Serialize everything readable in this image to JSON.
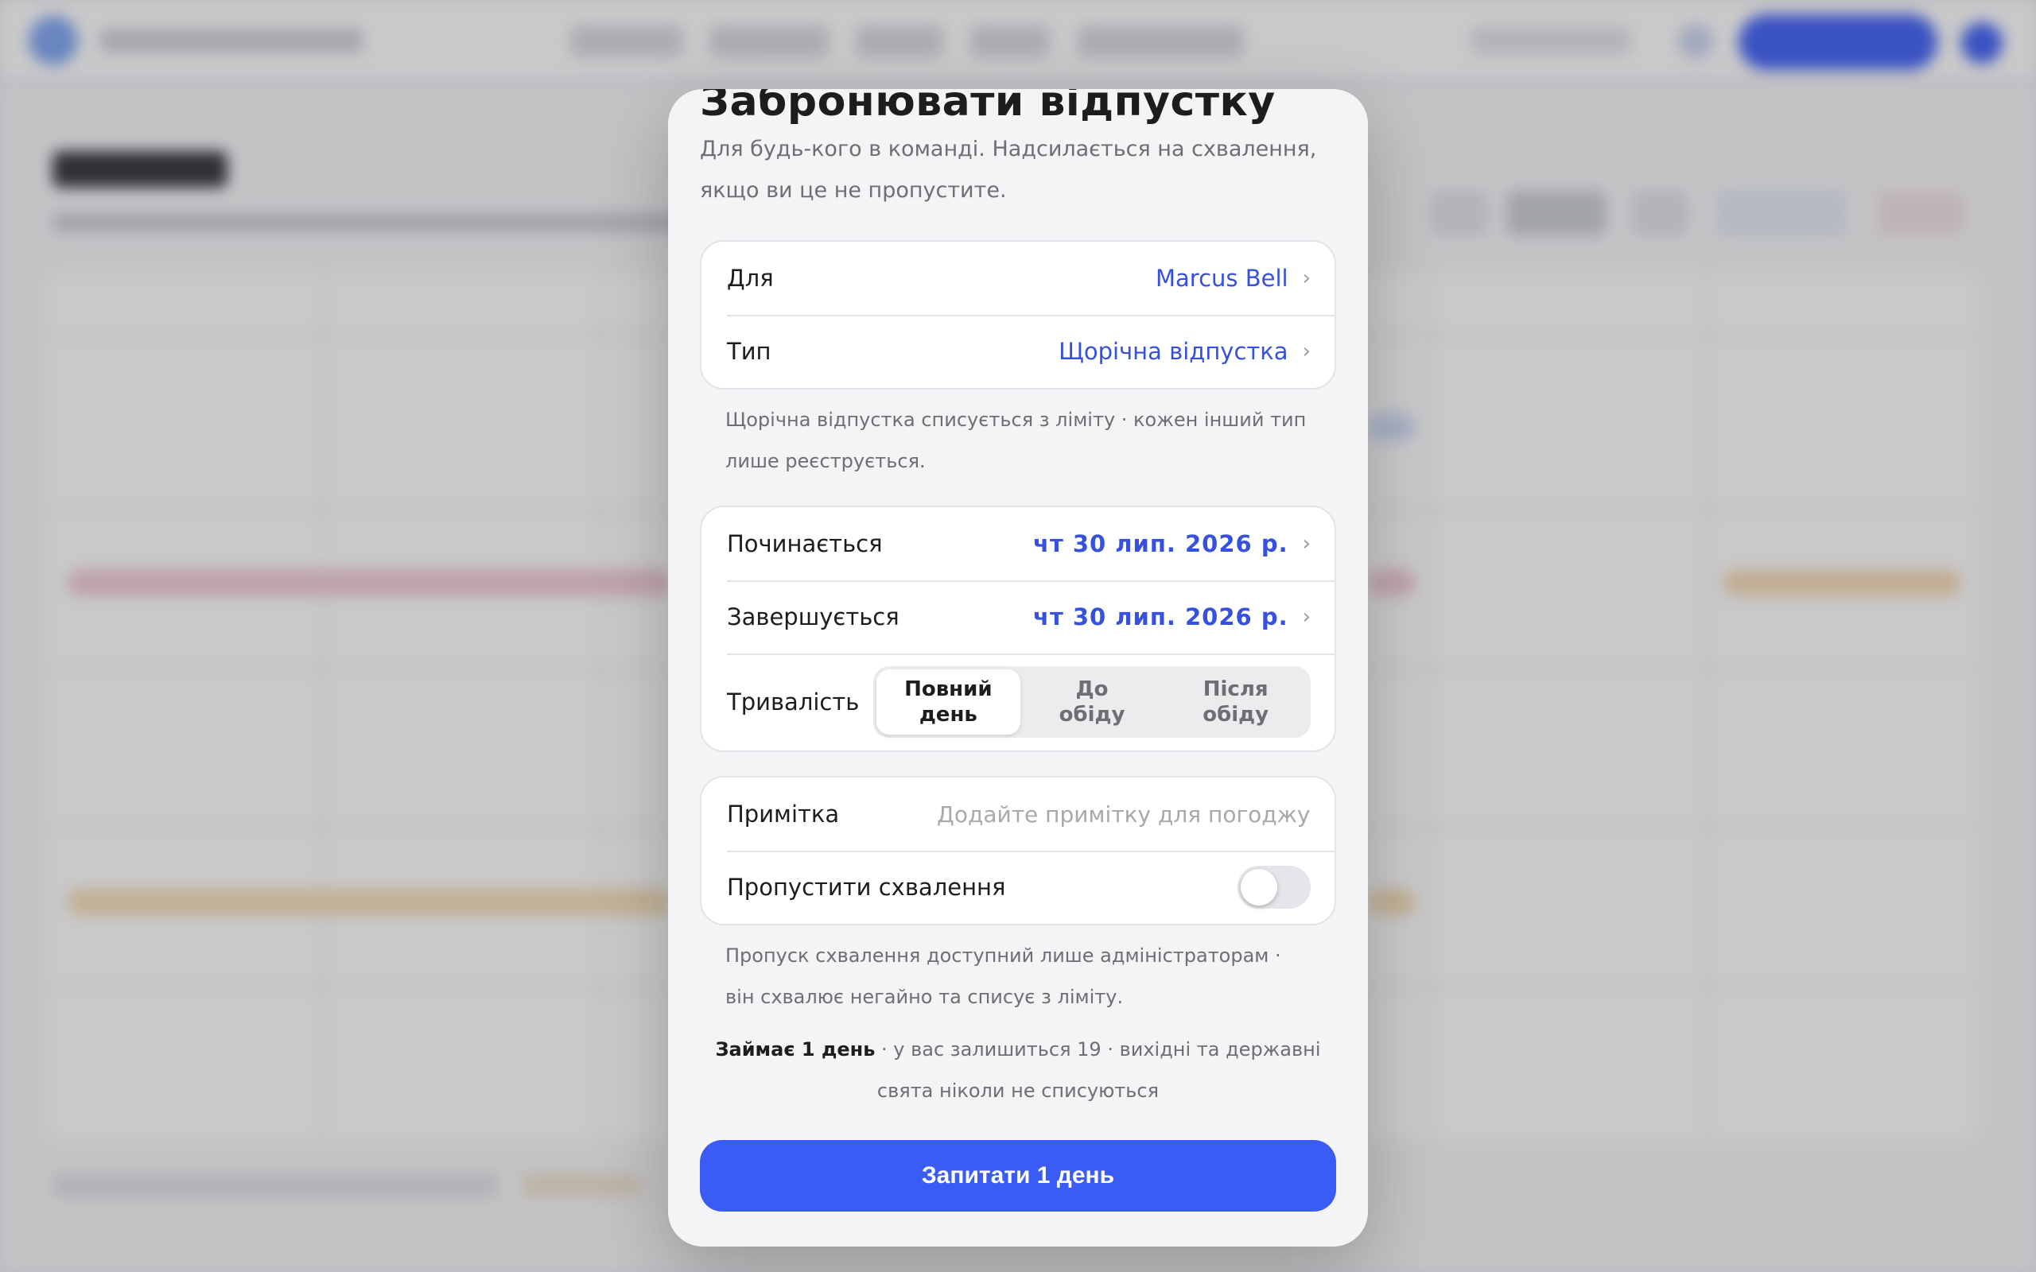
{
  "dialog": {
    "title": "Забронювати відпустку",
    "subtitle": "Для будь-кого в команді. Надсилається на схвалення, якщо ви це не пропустите.",
    "for_label": "Для",
    "for_value": "Marcus Bell",
    "type_label": "Тип",
    "type_value": "Щорічна відпустка",
    "type_note": "Щорічна відпустка списується з ліміту · кожен інший тип лише реєструється.",
    "starts_label": "Починається",
    "starts_value": "чт 30 лип. 2026 р.",
    "ends_label": "Завершується",
    "ends_value": "чт 30 лип. 2026 р.",
    "duration_label": "Тривалість",
    "duration_options": [
      {
        "line1": "Повний",
        "line2": "день",
        "selected": true
      },
      {
        "line1": "До",
        "line2": "обіду",
        "selected": false
      },
      {
        "line1": "Після",
        "line2": "обіду",
        "selected": false
      }
    ],
    "note_label": "Примітка",
    "note_placeholder": "Додайте примітку для погоджувача",
    "note_value": "",
    "skip_label": "Пропустити схвалення",
    "skip_enabled": false,
    "skip_note": "Пропуск схвалення доступний лише адміністраторам · він схвалює негайно та списує з ліміту.",
    "summary_bold": "Займає 1 день",
    "summary_rest": " · у вас залишиться 19 · вихідні та державні свята ніколи не списуються",
    "submit_label": "Запитати 1 день",
    "chevron": "›"
  },
  "colors": {
    "accent": "#3a5cf5",
    "value_text": "#3650e0",
    "sheet_bg": "#f4f4f6"
  },
  "icons": {
    "row_chevron": "chevron-right-icon"
  }
}
